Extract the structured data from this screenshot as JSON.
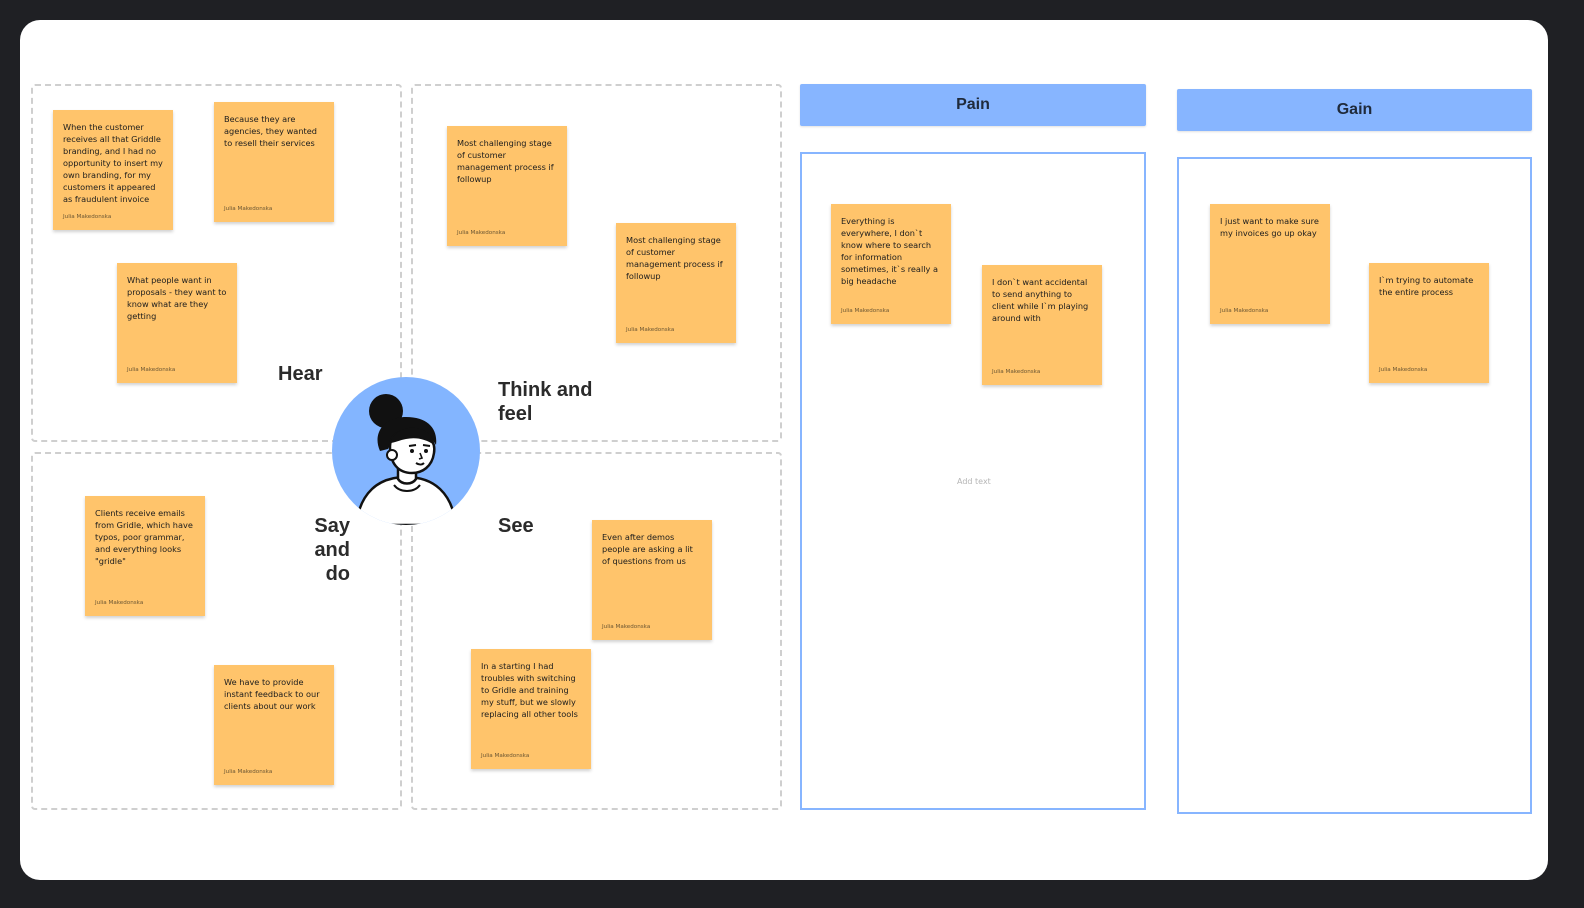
{
  "empathy_map": {
    "labels": {
      "hear": "Hear",
      "think_feel_1": "Think and",
      "think_feel_2": "feel",
      "say_do_1": "Say",
      "say_do_2": "and do",
      "see": "See"
    },
    "hear_notes": [
      {
        "text": "When the customer receives all that Griddle branding, and I had no opportunity to insert my own branding, for my customers it appeared as fraudulent invoice",
        "author": "Julia Makedonska"
      },
      {
        "text": "Because they are agencies, they wanted to resell their services",
        "author": "Julia Makedonska"
      },
      {
        "text": "What people want in proposals - they want to know what are they getting",
        "author": "Julia Makedonska"
      }
    ],
    "think_notes": [
      {
        "text": "Most challenging stage of customer management process if followup",
        "author": "Julia Makedonska"
      },
      {
        "text": "Most challenging stage of customer management process if followup",
        "author": "Julia Makedonska"
      }
    ],
    "say_notes": [
      {
        "text": "Clients receive emails from Gridle, which have typos, poor grammar, and everything looks \"gridle\"",
        "author": "Julia Makedonska"
      },
      {
        "text": "We have to provide instant feedback to our clients about our work",
        "author": "Julia Makedonska"
      }
    ],
    "see_notes": [
      {
        "text": "Even after demos people are asking a lit of questions from us",
        "author": "Julia Makedonska"
      },
      {
        "text": "In a starting I had troubles with switching to Gridle and training my stuff, but we slowly replacing all other tools",
        "author": "Julia Makedonska"
      }
    ]
  },
  "pain": {
    "title": "Pain",
    "add_text": "Add text",
    "notes": [
      {
        "text": "Everything is everywhere, I don`t know where to search for information sometimes, it`s really a big headache",
        "author": "Julia Makedonska"
      },
      {
        "text": "I don`t want accidental to send anything to client while I`m playing around with",
        "author": "Julia Makedonska"
      }
    ]
  },
  "gain": {
    "title": "Gain",
    "notes": [
      {
        "text": "I just want to make sure my invoices go up okay",
        "author": "Julia Makedonska"
      },
      {
        "text": "I`m trying to automate the entire process",
        "author": "Julia Makedonska"
      }
    ]
  },
  "colors": {
    "sticky": "#ffc46b",
    "accent_blue": "#87b5ff",
    "frame": "#1f2024"
  },
  "icons": {
    "avatar": "user-persona-illustration"
  }
}
